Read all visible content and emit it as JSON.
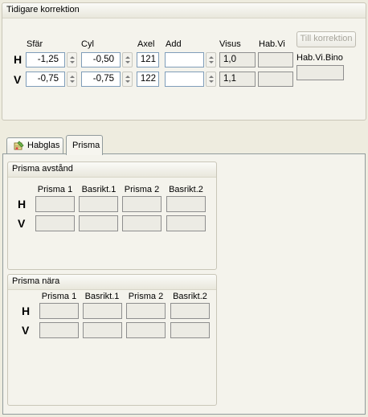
{
  "tidigare": {
    "title": "Tidigare korrektion",
    "headers": {
      "sfar": "Sfär",
      "cyl": "Cyl",
      "axel": "Axel",
      "add": "Add",
      "visus": "Visus",
      "habvi": "Hab.Vi"
    },
    "row_h": {
      "label": "H",
      "sfar": "-1,25",
      "cyl": "-0,50",
      "axel": "121",
      "add": "",
      "visus": "1,0",
      "habvi": ""
    },
    "row_v": {
      "label": "V",
      "sfar": "-0,75",
      "cyl": "-0,75",
      "axel": "122",
      "add": "",
      "visus": "1,1",
      "habvi": ""
    },
    "till_korrektion_button": "Till korrektion",
    "habvibino_label": "Hab.Vi.Bino",
    "habvibino_value": ""
  },
  "tabs": {
    "habglas": "Habglas",
    "prisma": "Prisma",
    "active": "prisma"
  },
  "prisma_avstand": {
    "title": "Prisma avstånd",
    "columns": [
      "Prisma 1",
      "Basrikt.1",
      "Prisma 2",
      "Basrikt.2"
    ],
    "row_h": "H",
    "row_v": "V"
  },
  "prisma_nara": {
    "title": "Prisma nära",
    "columns": [
      "Prisma 1",
      "Basrikt.1",
      "Prisma 2",
      "Basrikt.2"
    ],
    "row_h": "H",
    "row_v": "V"
  }
}
